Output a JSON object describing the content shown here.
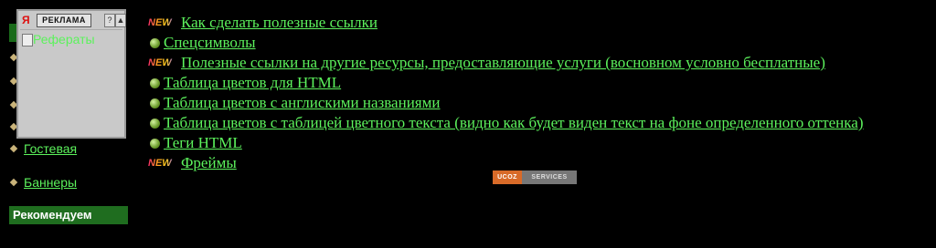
{
  "sidebar": {
    "links": [
      {
        "label": "Гостевая"
      },
      {
        "label": "Баннеры"
      }
    ],
    "recommend_label": "Рекомендуем"
  },
  "ad": {
    "logo": "Я",
    "label": "РЕКЛАМА",
    "help_btn": "?",
    "up_btn": "▲",
    "image_alt": "Рефераты"
  },
  "links": [
    {
      "marker": "new-badge",
      "badge": "NEW",
      "label": "Как сделать полезные ссылки"
    },
    {
      "marker": "bullet",
      "label": "Спецсимволы"
    },
    {
      "marker": "new-badge",
      "badge": "NEW",
      "label": "Полезные ссылки на другие ресурсы, предоставляющие услуги (восновном условно бесплатные)"
    },
    {
      "marker": "bullet",
      "label": "Таблица цветов для HTML"
    },
    {
      "marker": "bullet",
      "label": "Таблица цветов с англискими названиями"
    },
    {
      "marker": "bullet",
      "label": "Таблица цветов с таблицей цветного текста (видно как будет виден текст на фоне определенного оттенка)"
    },
    {
      "marker": "bullet",
      "label": "Теги HTML"
    },
    {
      "marker": "new-badge",
      "badge": "NEW",
      "label": "Фреймы"
    }
  ],
  "ucoz": {
    "left": "UCOZ",
    "right": "SERVICES"
  },
  "colors": {
    "background": "#000000",
    "link": "#5cf25c",
    "recommend_bg": "#1f6d1f",
    "ucoz_orange": "#d86a28"
  }
}
